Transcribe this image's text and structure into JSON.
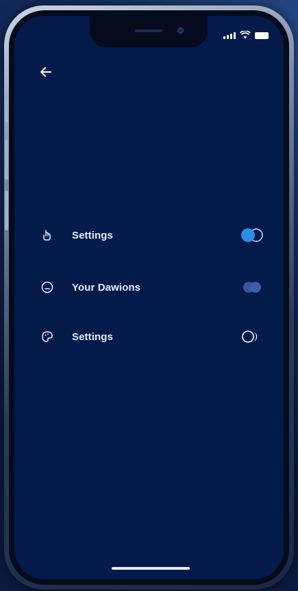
{
  "status_bar": {
    "icons": [
      "cellular-signal-icon",
      "wifi-icon",
      "battery-icon"
    ]
  },
  "nav": {
    "back_icon": "back-arrow-icon"
  },
  "settings_list": [
    {
      "label": "Settings",
      "icon": "hand-touch-icon",
      "toggle_state": "on",
      "toggle_color": "#2b8de8"
    },
    {
      "label": "Your Dawions",
      "icon": "face-icon",
      "toggle_state": "on",
      "toggle_color": "#3a5ea8"
    },
    {
      "label": "Settings",
      "icon": "palette-icon",
      "toggle_state": "off",
      "toggle_color": "#ffffff"
    }
  ],
  "colors": {
    "screen_background": "#031a4a",
    "text": "#e8eefb",
    "accent": "#2b8de8"
  }
}
